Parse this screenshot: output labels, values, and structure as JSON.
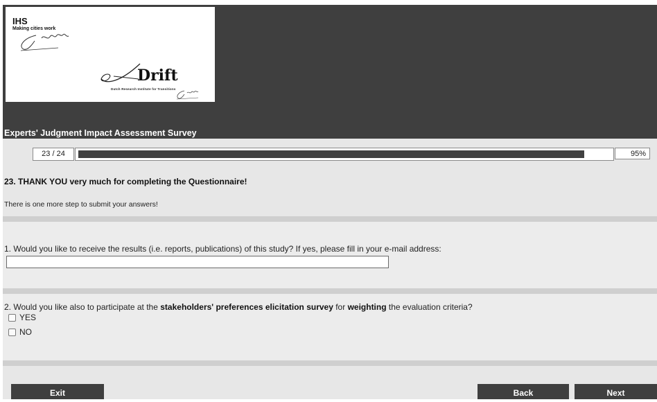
{
  "header": {
    "logo_ihs": "IHS",
    "logo_tagline": "Making cities work",
    "logo_drift": "Drift",
    "logo_drift_sub": "Dutch Research Institute for Transitions",
    "survey_title": "Experts' Judgment Impact Assessment Survey"
  },
  "progress": {
    "count": "23 / 24",
    "percent_label": "95%",
    "fraction": 0.95
  },
  "content": {
    "heading": "23. THANK YOU very much for completing the Questionnaire!",
    "intro": "There is one more step to submit your answers!"
  },
  "q1": {
    "text": "1. Would you like to receive the results (i.e. reports, publications) of this study? If yes, please fill in your e-mail address:",
    "email_value": ""
  },
  "q2": {
    "part1": "2. Would you like also to participate at the ",
    "bold1": "stakeholders' preferences elicitation survey",
    "part2": " for ",
    "bold2": "weighting",
    "part3": " the evaluation criteria?",
    "options": [
      "YES",
      "NO"
    ]
  },
  "buttons": {
    "exit": "Exit",
    "back": "Back",
    "next": "Next"
  },
  "colors": {
    "header_bg": "#3f3f3f",
    "page_bg": "#e7e7e7",
    "button_bg": "#3f3f3f",
    "progress_fill": "#414141"
  }
}
